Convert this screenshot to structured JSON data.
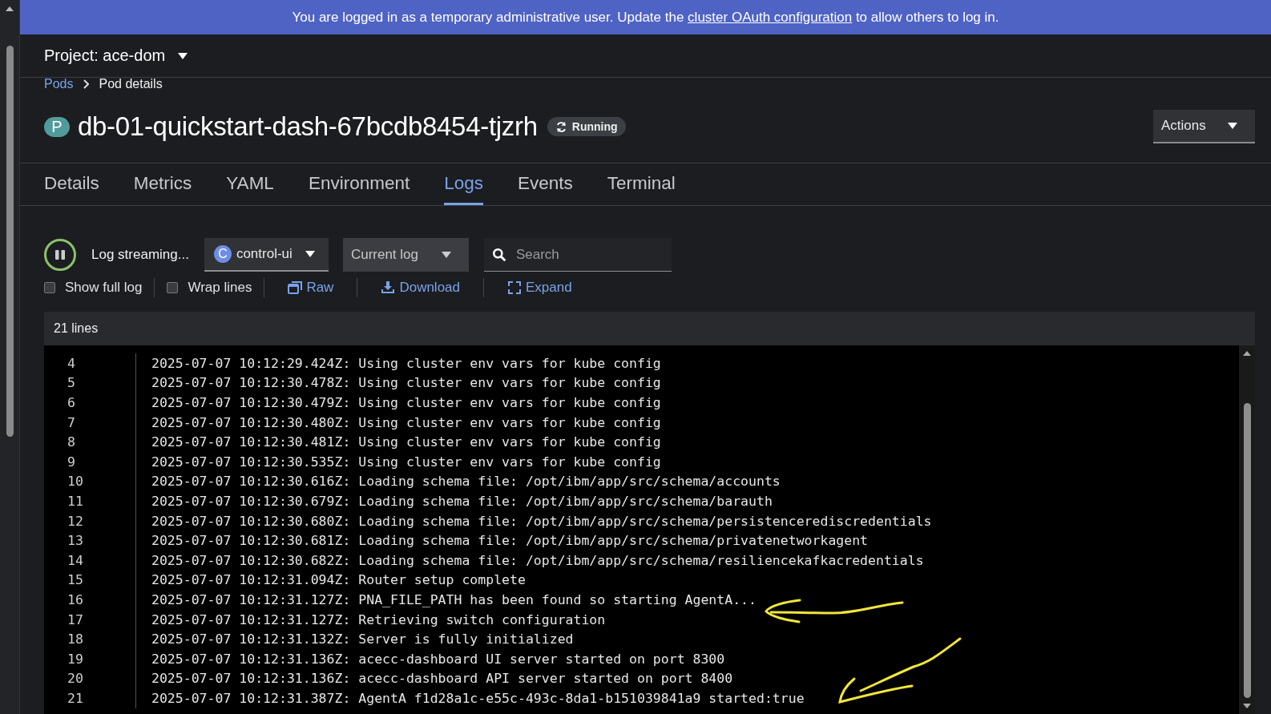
{
  "banner": {
    "text": "You are logged in as a temporary administrative user. Update the",
    "link": "cluster OAuth configuration",
    "after": "to allow others to log in."
  },
  "project": {
    "label": "Project: ace-dom"
  },
  "breadcrumb": [
    {
      "label": "Pods",
      "kind": "link"
    },
    {
      "label": "Pod details",
      "kind": "current"
    }
  ],
  "pod": {
    "badge": "P",
    "name": "db-01-quickstart-dash-67bcdb8454-tjzrh",
    "status": "Running"
  },
  "actions": {
    "label": "Actions"
  },
  "tabs": [
    {
      "label": "Details",
      "selected": false
    },
    {
      "label": "Metrics",
      "selected": false
    },
    {
      "label": "YAML",
      "selected": false
    },
    {
      "label": "Environment",
      "selected": false
    },
    {
      "label": "Logs",
      "selected": true
    },
    {
      "label": "Events",
      "selected": false
    },
    {
      "label": "Terminal",
      "selected": false
    }
  ],
  "toolbar": {
    "streaming": {
      "label": "Log streaming...",
      "paused": false
    },
    "container": {
      "badge": "C",
      "value": "control-ui"
    },
    "log_select": {
      "value": "Current log"
    },
    "search": {
      "placeholder": "Search"
    },
    "options": [
      {
        "kind": "checkbox",
        "label": "Show full log",
        "checked": false
      },
      {
        "kind": "checkbox",
        "label": "Wrap lines",
        "checked": false
      },
      {
        "kind": "raw",
        "label": "Raw"
      },
      {
        "kind": "download",
        "label": "Download"
      },
      {
        "kind": "expand",
        "label": "Expand"
      }
    ]
  },
  "log": {
    "count": "21 lines",
    "lines": [
      {
        "number": "4",
        "text": "2025-07-07 10:12:29.424Z: Using cluster env vars for kube config"
      },
      {
        "number": "5",
        "text": "2025-07-07 10:12:30.478Z: Using cluster env vars for kube config"
      },
      {
        "number": "6",
        "text": "2025-07-07 10:12:30.479Z: Using cluster env vars for kube config"
      },
      {
        "number": "7",
        "text": "2025-07-07 10:12:30.480Z: Using cluster env vars for kube config"
      },
      {
        "number": "8",
        "text": "2025-07-07 10:12:30.481Z: Using cluster env vars for kube config"
      },
      {
        "number": "9",
        "text": "2025-07-07 10:12:30.535Z: Using cluster env vars for kube config"
      },
      {
        "number": "10",
        "text": "2025-07-07 10:12:30.616Z: Loading schema file: /opt/ibm/app/src/schema/accounts"
      },
      {
        "number": "11",
        "text": "2025-07-07 10:12:30.679Z: Loading schema file: /opt/ibm/app/src/schema/barauth"
      },
      {
        "number": "12",
        "text": "2025-07-07 10:12:30.680Z: Loading schema file: /opt/ibm/app/src/schema/persistencerediscredentials"
      },
      {
        "number": "13",
        "text": "2025-07-07 10:12:30.681Z: Loading schema file: /opt/ibm/app/src/schema/privatenetworkagent"
      },
      {
        "number": "14",
        "text": "2025-07-07 10:12:30.682Z: Loading schema file: /opt/ibm/app/src/schema/resiliencekafkacredentials"
      },
      {
        "number": "15",
        "text": "2025-07-07 10:12:31.094Z: Router setup complete"
      },
      {
        "number": "16",
        "text": "2025-07-07 10:12:31.127Z: PNA_FILE_PATH has been found so starting AgentA..."
      },
      {
        "number": "17",
        "text": "2025-07-07 10:12:31.127Z: Retrieving switch configuration"
      },
      {
        "number": "18",
        "text": "2025-07-07 10:12:31.132Z: Server is fully initialized"
      },
      {
        "number": "19",
        "text": "2025-07-07 10:12:31.136Z: acecc-dashboard UI server started on port 8300"
      },
      {
        "number": "20",
        "text": "2025-07-07 10:12:31.136Z: acecc-dashboard API server started on port 8400"
      },
      {
        "number": "21",
        "text": "2025-07-07 10:12:31.387Z: AgentA f1d28a1c-e55c-493c-8da1-b151039841a9 started:true"
      }
    ]
  }
}
